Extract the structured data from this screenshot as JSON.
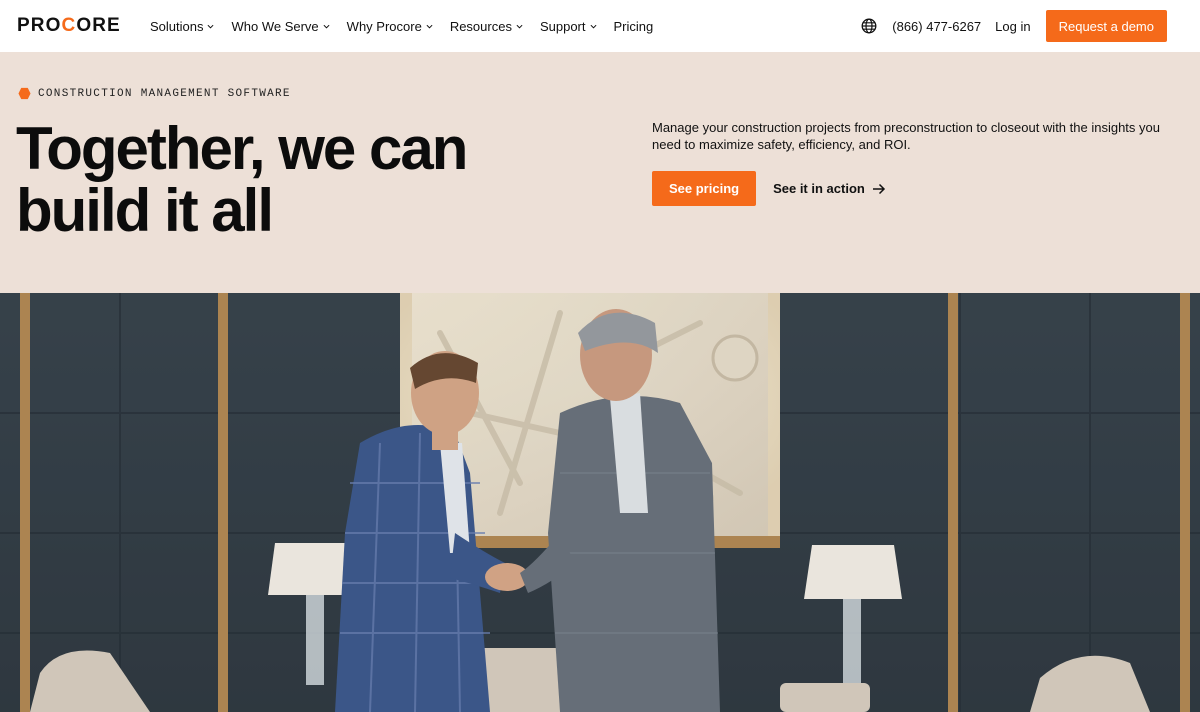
{
  "header": {
    "logo": {
      "text_prefix": "PRO",
      "text_accent": "C",
      "text_suffix": "ORE"
    },
    "nav": [
      {
        "label": "Solutions",
        "has_dropdown": true
      },
      {
        "label": "Who We Serve",
        "has_dropdown": true
      },
      {
        "label": "Why Procore",
        "has_dropdown": true
      },
      {
        "label": "Resources",
        "has_dropdown": true
      },
      {
        "label": "Support",
        "has_dropdown": true
      },
      {
        "label": "Pricing",
        "has_dropdown": false
      }
    ],
    "globe_icon": "globe-icon",
    "phone": "(866) 477-6267",
    "login_label": "Log in",
    "demo_label": "Request a demo"
  },
  "hero": {
    "eyebrow": "CONSTRUCTION MANAGEMENT SOFTWARE",
    "headline_line1": "Together, we can",
    "headline_line2": "build it all",
    "description": "Manage your construction projects from preconstruction to closeout with the insights you need to maximize safety, efficiency, and ROI.",
    "primary_cta": "See pricing",
    "secondary_cta": "See it in action"
  },
  "colors": {
    "brand_orange": "#f56a1a",
    "hero_background": "#ede0d7",
    "text_dark": "#111111"
  }
}
